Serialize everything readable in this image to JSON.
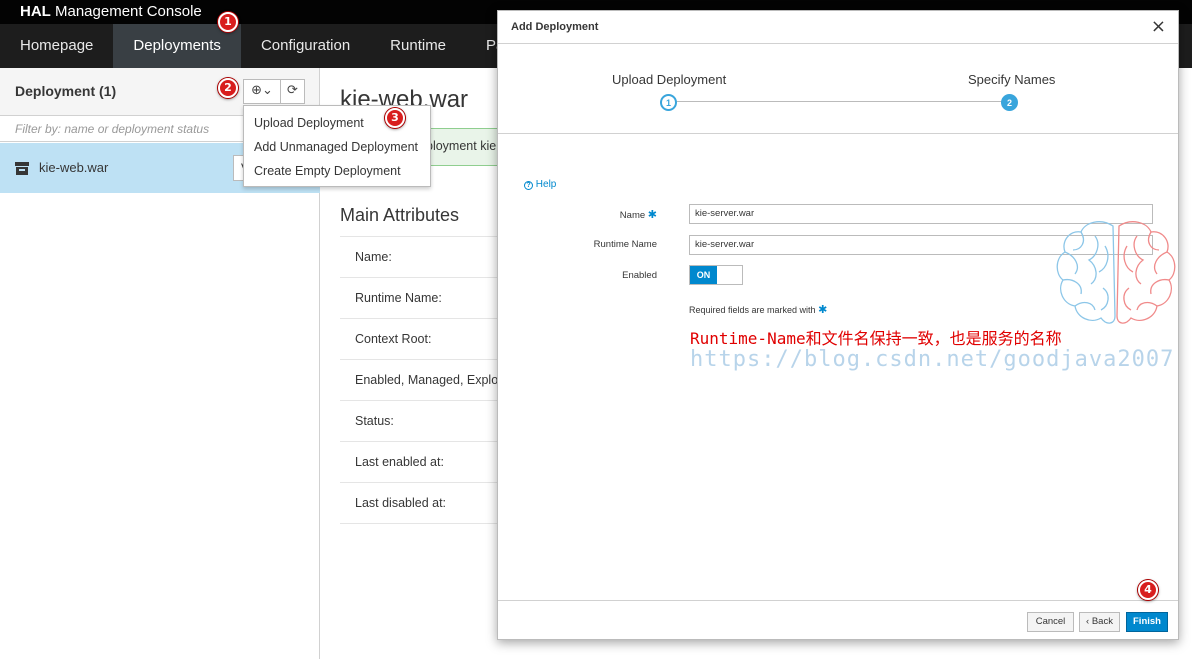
{
  "app": {
    "brand": "HAL",
    "title": "Management Console"
  },
  "nav": {
    "items": [
      "Homepage",
      "Deployments",
      "Configuration",
      "Runtime",
      "Pa"
    ]
  },
  "left": {
    "title": "Deployment (1)",
    "add_button_label": "⊕⌄",
    "refresh_label": "⟳",
    "filter_placeholder": "Filter by: name or deployment status",
    "deployment_name": "kie-web.war",
    "row_button_label": "V"
  },
  "dropdown": {
    "items": [
      "Upload Deployment",
      "Add Unmanaged Deployment",
      "Create Empty Deployment"
    ]
  },
  "main": {
    "title": "kie-web.war",
    "alert_text": "ployment kie",
    "section_title": "Main Attributes",
    "attributes": [
      "Name:",
      "Runtime Name:",
      "Context Root:",
      "Enabled, Managed, Exploded:",
      "Status:",
      "Last enabled at:",
      "Last disabled at:"
    ]
  },
  "dialog": {
    "title": "Add Deployment",
    "close_label": "×",
    "steps": [
      {
        "label": "Upload Deployment",
        "number": "1"
      },
      {
        "label": "Specify Names",
        "number": "2"
      }
    ],
    "help_label": "Help",
    "help_icon": "?",
    "fields": {
      "name_label": "Name",
      "name_value": "kie-server.war",
      "runtime_name_label": "Runtime Name",
      "runtime_name_value": "kie-server.war",
      "enabled_label": "Enabled",
      "enabled_value": "ON"
    },
    "required_note": "Required fields are marked with",
    "required_marker": "✱",
    "annotation": "Runtime-Name和文件名保持一致，也是服务的名称",
    "watermark": "https://blog.csdn.net/goodjava2007",
    "buttons": {
      "cancel": "Cancel",
      "back": "‹ Back",
      "finish": "Finish"
    }
  },
  "markers": [
    "1",
    "2",
    "3",
    "4"
  ],
  "colors": {
    "accent": "#0088ce",
    "selected_row": "#bee1f4",
    "nav_active": "#393f44",
    "annotation": "#e00000",
    "marker": "#d81e1e"
  }
}
